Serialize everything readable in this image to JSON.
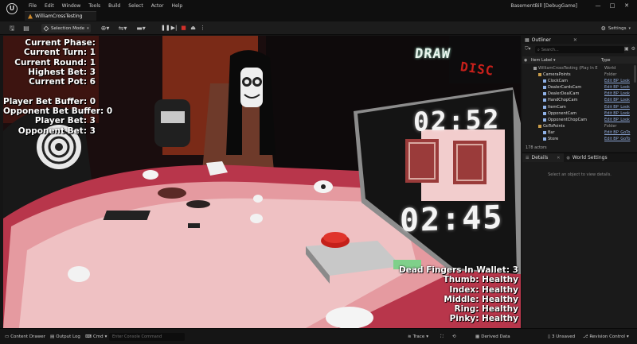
{
  "app": {
    "window_title": "BasementBill [DebugGame]",
    "project_tab": "WilliamCrossTesting",
    "menu": [
      "File",
      "Edit",
      "Window",
      "Tools",
      "Build",
      "Select",
      "Actor",
      "Help"
    ],
    "window_controls": [
      "—",
      "□",
      "✕"
    ]
  },
  "toolbar": {
    "selection_mode": "Selection Mode",
    "settings": "Settings"
  },
  "hud": {
    "left_lines": [
      "Current Phase:",
      "Current Turn: 1",
      "Current Round: 1",
      "Highest Bet: 3",
      "Current Pot: 6",
      "",
      "Player Bet Buffer: 0",
      "Opponent Bet Buffer: 0",
      "Player Bet: 3",
      "Opponent Bet: 3"
    ],
    "right_lines": [
      "Dead Fingers In Wallet: 3",
      "Thumb: Healthy",
      "Index: Healthy",
      "Middle: Healthy",
      "Ring: Healthy",
      "Pinky: Healthy"
    ],
    "draw_label": "DRAW",
    "discard_label": "DISC",
    "timer_top": "02:52",
    "timer_bottom": "02:45"
  },
  "outliner": {
    "title": "Outliner",
    "close": "✕",
    "search_placeholder": "Search...",
    "col_label": "Item Label ▾",
    "col_type": "Type",
    "rows": [
      {
        "name": "WilliamCrossTesting (Play In E",
        "type": "World",
        "indent": 0,
        "link": false
      },
      {
        "name": "CameraPoints",
        "type": "Folder",
        "indent": 1,
        "link": false
      },
      {
        "name": "ClockCam",
        "type": "Edit BP_Look",
        "indent": 2,
        "link": true
      },
      {
        "name": "DealerCardsCam",
        "type": "Edit BP_Look",
        "indent": 2,
        "link": true
      },
      {
        "name": "DealerDealCam",
        "type": "Edit BP_Look",
        "indent": 2,
        "link": true
      },
      {
        "name": "HandChopCam",
        "type": "Edit BP_Look",
        "indent": 2,
        "link": true
      },
      {
        "name": "ItemCam",
        "type": "Edit BP_Look",
        "indent": 2,
        "link": true
      },
      {
        "name": "OpponentCam",
        "type": "Edit BP_Look",
        "indent": 2,
        "link": true
      },
      {
        "name": "OpponentChopCam",
        "type": "Edit BP_Look",
        "indent": 2,
        "link": true
      },
      {
        "name": "GoToPoints",
        "type": "Folder",
        "indent": 1,
        "link": false
      },
      {
        "name": "Bar",
        "type": "Edit BP_GoTo",
        "indent": 2,
        "link": true
      },
      {
        "name": "Store",
        "type": "Edit BP_GoTo",
        "indent": 2,
        "link": true
      }
    ],
    "actor_count": "178 actors"
  },
  "details": {
    "tab_details": "Details",
    "tab_world": "World Settings",
    "empty_text": "Select an object to view details."
  },
  "statusbar": {
    "content_drawer": "Content Drawer",
    "output_log": "Output Log",
    "cmd": "Cmd",
    "console_placeholder": "Enter Console Command",
    "trace": "Trace",
    "derived_data": "Derived Data",
    "unsaved": "3 Unsaved",
    "revision": "Revision Control"
  },
  "colors": {
    "table_pink": "#e59aa0",
    "wall_red": "#7a1e16",
    "timer_panel": "#141414",
    "red_button": "#c4201a",
    "link_blue": "#8fa9d9"
  }
}
